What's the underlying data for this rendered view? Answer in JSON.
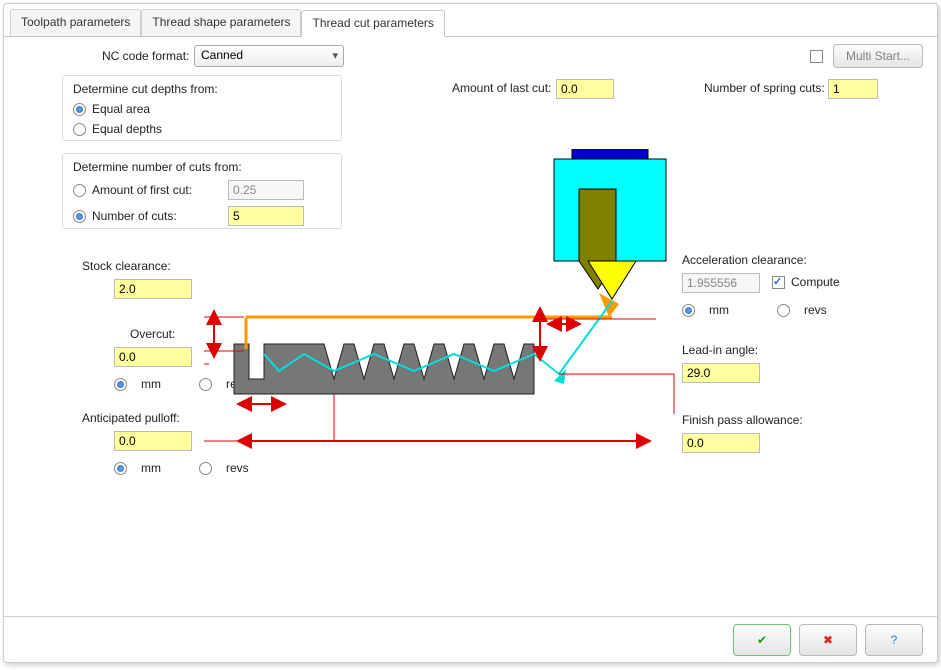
{
  "tabs": {
    "toolpath": "Toolpath parameters",
    "thread_shape": "Thread shape parameters",
    "thread_cut": "Thread cut parameters"
  },
  "nc_code_format_label": "NC code format:",
  "nc_code_format_value": "Canned",
  "multi_start_button": "Multi Start...",
  "cut_depths": {
    "title": "Determine cut depths from:",
    "equal_area": "Equal area",
    "equal_depths": "Equal depths"
  },
  "num_cuts": {
    "title": "Determine number of cuts from:",
    "amount_first_cut": "Amount of first cut:",
    "amount_first_cut_value": "0.25",
    "number_of_cuts": "Number of cuts:",
    "number_of_cuts_value": "5"
  },
  "amount_last_cut_label": "Amount of last cut:",
  "amount_last_cut_value": "0.0",
  "spring_cuts_label": "Number of spring cuts:",
  "spring_cuts_value": "1",
  "stock_clearance_label": "Stock clearance:",
  "stock_clearance_value": "2.0",
  "overcut_label": "Overcut:",
  "overcut_value": "0.0",
  "overcut_mm": "mm",
  "overcut_revs": "revs",
  "anticipated_pulloff_label": "Anticipated pulloff:",
  "anticipated_pulloff_value": "0.0",
  "anticipated_mm": "mm",
  "anticipated_revs": "revs",
  "accel_clearance_label": "Acceleration clearance:",
  "accel_clearance_value": "1.955556",
  "accel_compute": "Compute",
  "accel_mm": "mm",
  "accel_revs": "revs",
  "lead_in_angle_label": "Lead-in angle:",
  "lead_in_angle_value": "29.0",
  "finish_pass_label": "Finish pass allowance:",
  "finish_pass_value": "0.0"
}
